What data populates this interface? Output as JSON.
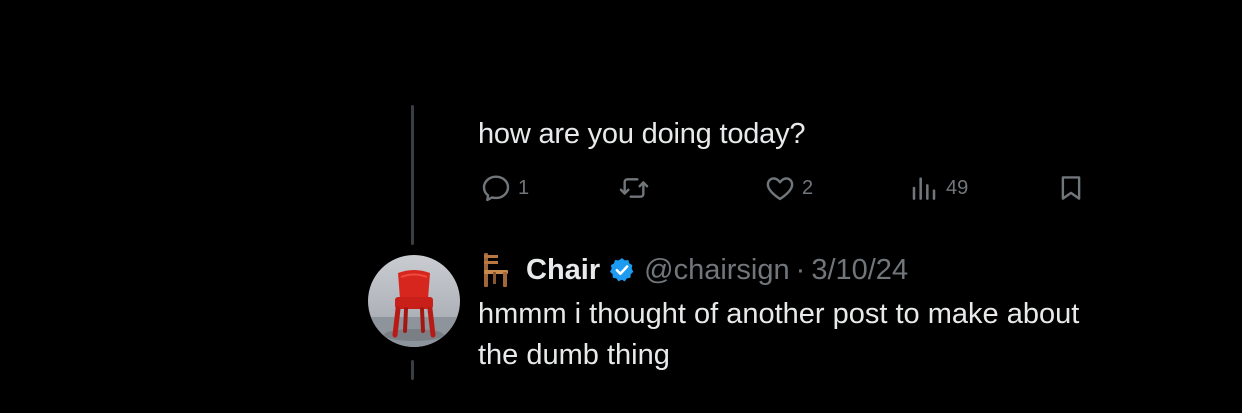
{
  "parent_post": {
    "text": "how are you doing today?",
    "actions": {
      "reply_count": "1",
      "retweet_count": "",
      "like_count": "2",
      "view_count": "49"
    }
  },
  "reply_post": {
    "author_emoji": "chair-emoji",
    "display_name": "Chair",
    "verified": true,
    "handle": "@chairsign",
    "separator": "·",
    "date": "3/10/24",
    "text": "hmmm i thought of another post to make about the dumb thing"
  },
  "colors": {
    "background": "#000000",
    "primary_text": "#e7e9ea",
    "secondary_text": "#71767b",
    "verified_badge": "#1d9bf0",
    "thread_line": "#3a3d41"
  }
}
